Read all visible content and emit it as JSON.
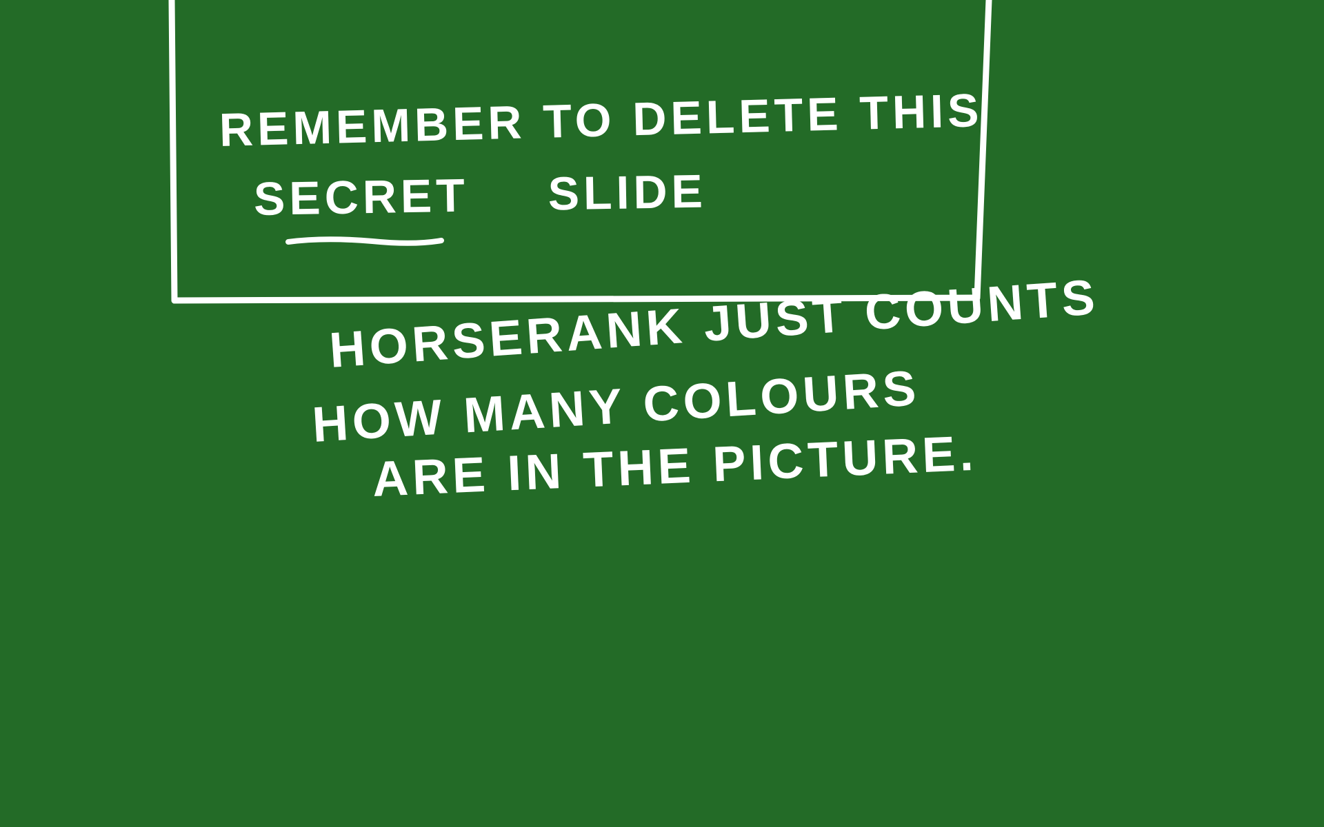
{
  "slide": {
    "background_color": "#236b27",
    "ink_color": "#ffffff",
    "boxed_note": {
      "line1": "Remember to delete this",
      "line2_emphasis": "secret",
      "line2_rest": "slide"
    },
    "caption": {
      "line1": "Horserank just counts",
      "line2": "how many colours",
      "line3": "are in the picture."
    }
  }
}
